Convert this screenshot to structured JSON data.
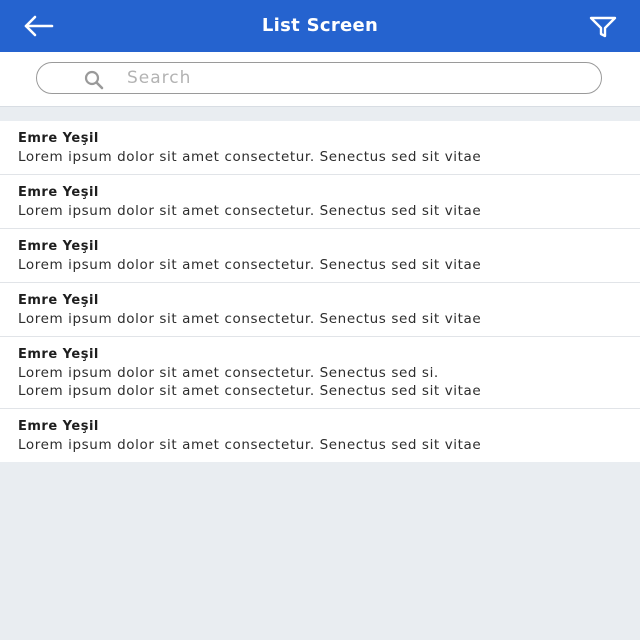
{
  "colors": {
    "header_bg": "#2563cf",
    "header_text": "#ffffff",
    "page_bg": "#e9edf1",
    "list_bg": "#ffffff"
  },
  "header": {
    "title": "List Screen",
    "back_icon": "arrow-left-icon",
    "filter_icon": "filter-icon"
  },
  "search": {
    "placeholder": "Search",
    "value": "",
    "icon": "search-icon"
  },
  "list": {
    "items": [
      {
        "name": "Emre Yeşil",
        "lines": [
          "Lorem ipsum dolor sit amet consectetur. Senectus sed sit vitae"
        ]
      },
      {
        "name": "Emre Yeşil",
        "lines": [
          "Lorem ipsum dolor sit amet consectetur. Senectus sed sit vitae"
        ]
      },
      {
        "name": "Emre Yeşil",
        "lines": [
          "Lorem ipsum dolor sit amet consectetur. Senectus sed sit vitae"
        ]
      },
      {
        "name": "Emre Yeşil",
        "lines": [
          "Lorem ipsum dolor sit amet consectetur. Senectus sed sit vitae"
        ]
      },
      {
        "name": "Emre Yeşil",
        "lines": [
          "Lorem ipsum dolor sit amet consectetur. Senectus sed si.",
          "Lorem ipsum dolor sit amet consectetur. Senectus sed sit vitae"
        ]
      },
      {
        "name": "Emre Yeşil",
        "lines": [
          "Lorem ipsum dolor sit amet consectetur. Senectus sed sit vitae"
        ]
      }
    ]
  }
}
